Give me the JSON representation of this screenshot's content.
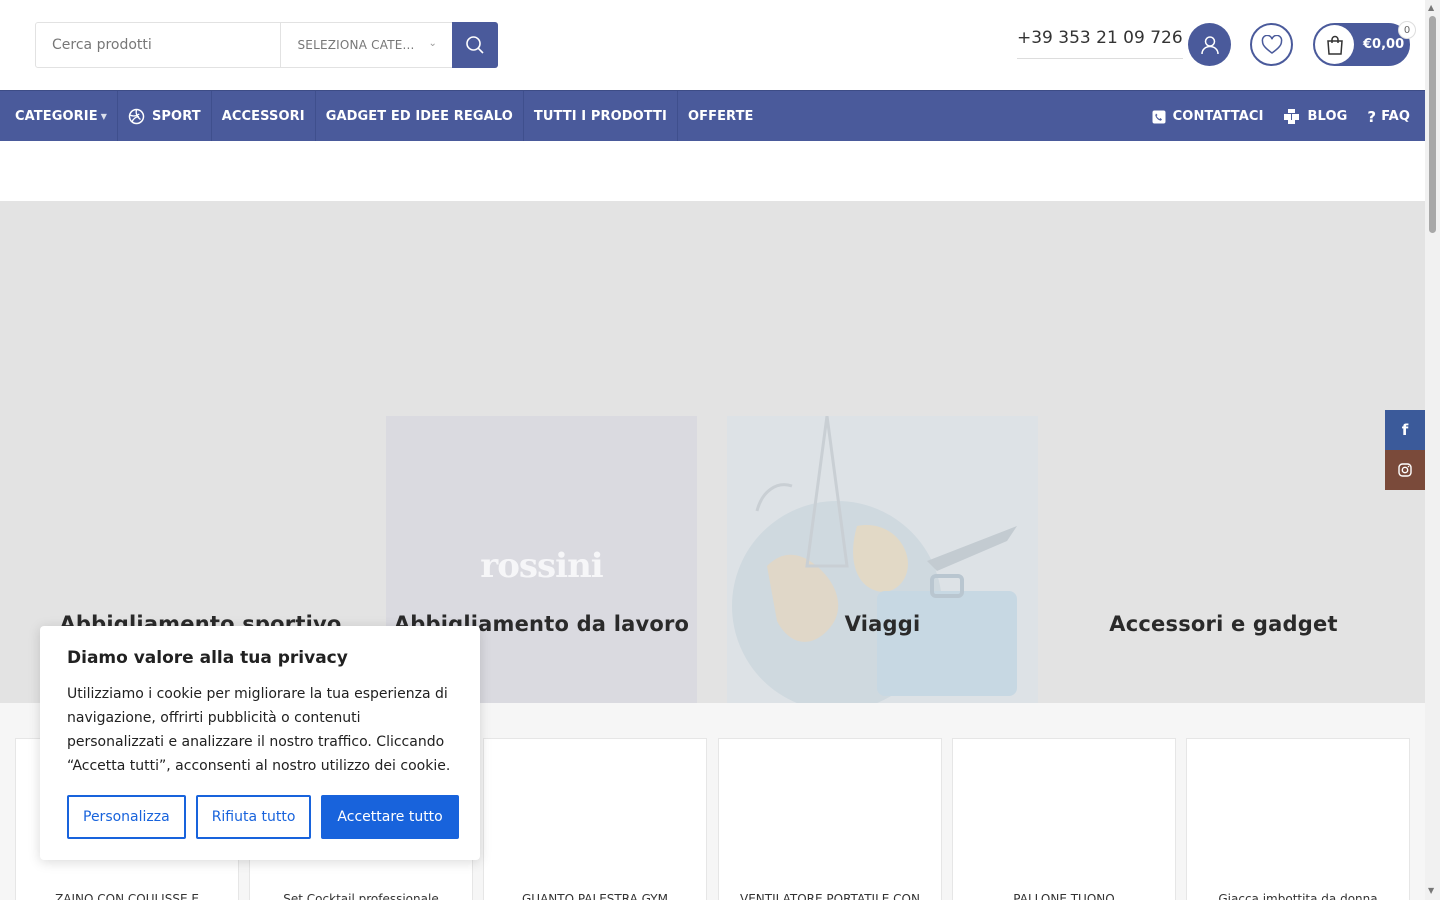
{
  "header": {
    "search_placeholder": "Cerca prodotti",
    "category_select": "SELEZIONA CATE...",
    "phone": "+39 353 21 09 726",
    "cart_total": "€0,00",
    "cart_count": "0"
  },
  "nav": {
    "items": [
      {
        "label": "CATEGORIE"
      },
      {
        "label": "SPORT"
      },
      {
        "label": "ACCESSORI"
      },
      {
        "label": "GADGET ED IDEE REGALO"
      },
      {
        "label": "TUTTI I PRODOTTI"
      },
      {
        "label": "OFFERTE"
      }
    ],
    "right": [
      {
        "label": "CONTATTACI"
      },
      {
        "label": "BLOG"
      },
      {
        "label": "FAQ"
      }
    ]
  },
  "hero": {
    "tiles": [
      {
        "label": "Abbigliamento sportivo"
      },
      {
        "label": "Abbigliamento da lavoro",
        "logo_text": "rossini"
      },
      {
        "label": "Viaggi"
      },
      {
        "label": "Accessori e gadget"
      }
    ]
  },
  "social": {
    "facebook": "f",
    "instagram": "instagram-icon"
  },
  "products": [
    {
      "name": "ZAINO CON COULISSE E"
    },
    {
      "name": "Set Cocktail professionale"
    },
    {
      "name": "GUANTO PALESTRA GYM"
    },
    {
      "name": "VENTILATORE PORTATILE CON"
    },
    {
      "name": "PALLONE TUONO"
    },
    {
      "name": "Giacca imbottita da donna"
    }
  ],
  "cookie": {
    "title": "Diamo valore alla tua privacy",
    "text": "Utilizziamo i cookie per migliorare la tua esperienza di navigazione, offrirti pubblicità o contenuti personalizzati e analizzare il nostro traffico. Cliccando “Accetta tutti”, acconsenti al nostro utilizzo dei cookie.",
    "customize": "Personalizza",
    "reject": "Rifiuta tutto",
    "accept": "Accettare tutto"
  },
  "colors": {
    "brand": "#4a5a9b",
    "cookie_blue": "#1863dc"
  }
}
